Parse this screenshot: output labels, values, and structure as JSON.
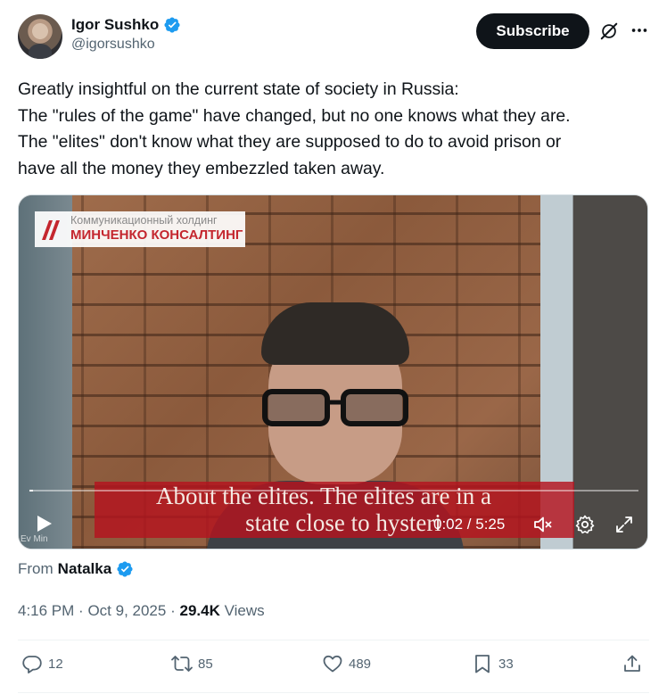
{
  "author": {
    "display_name": "Igor Sushko",
    "handle": "@igorsushko",
    "verified": true
  },
  "header": {
    "subscribe_label": "Subscribe",
    "icons": [
      "grok-icon",
      "more-icon"
    ]
  },
  "tweet": {
    "lines": [
      "Greatly insightful on the current state of society in Russia:",
      "The \"rules of the game\" have changed, but no one knows what they are.",
      "The \"elites\" don't know what they are supposed to do to avoid prison or",
      "have all the money they embezzled taken away."
    ]
  },
  "video": {
    "logo_top": "Коммуникационный холдинг",
    "logo_bottom": "МИНЧЕНКО КОНСАЛТИНГ",
    "subtitle_line1": "About the elites. The elites are in a",
    "subtitle_line2": "state close to hysteri",
    "watermark": "Ev Min",
    "time": "0:02 / 5:25",
    "progress": 0.006,
    "accent_color": "#c4262e"
  },
  "source": {
    "prefix": "From",
    "name": "Natalka",
    "verified": true
  },
  "meta": {
    "time": "4:16 PM",
    "separator": "·",
    "date": "Oct 9, 2025",
    "views_count": "29.4K",
    "views_label": "Views"
  },
  "actions": {
    "replies": "12",
    "reposts": "85",
    "likes": "489",
    "bookmarks": "33"
  },
  "colors": {
    "text": "#0f1419",
    "secondary": "#536471",
    "verified_badge": "#1d9bf0"
  }
}
